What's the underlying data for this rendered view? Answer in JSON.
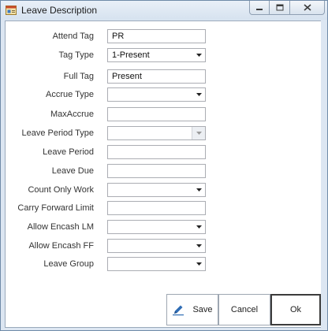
{
  "window": {
    "title": "Leave Description",
    "controls": [
      "minimize-icon",
      "maximize-icon",
      "close-icon"
    ]
  },
  "fields": [
    {
      "label": "Attend Tag",
      "type": "text",
      "value": "PR"
    },
    {
      "label": "Tag Type",
      "type": "combo",
      "value": "1-Present"
    },
    {
      "label": "Full Tag",
      "type": "text",
      "value": "Present"
    },
    {
      "label": "Accrue Type",
      "type": "combo",
      "value": ""
    },
    {
      "label": "MaxAccrue",
      "type": "text",
      "value": ""
    },
    {
      "label": "Leave Period Type",
      "type": "combo",
      "value": "",
      "disabled": true
    },
    {
      "label": "Leave Period",
      "type": "text",
      "value": ""
    },
    {
      "label": "Leave Due",
      "type": "text",
      "value": ""
    },
    {
      "label": "Count Only Work",
      "type": "combo",
      "value": ""
    },
    {
      "label": "Carry Forward Limit",
      "type": "text",
      "value": ""
    },
    {
      "label": "Allow Encash LM",
      "type": "combo",
      "value": ""
    },
    {
      "label": "Allow Encash FF",
      "type": "combo",
      "value": ""
    },
    {
      "label": "Leave Group",
      "type": "combo",
      "value": ""
    }
  ],
  "buttons": {
    "save": "Save",
    "cancel": "Cancel",
    "ok": "Ok"
  },
  "colors": {
    "titlebar": "#d6e2ef",
    "border": "#abadb3",
    "save_icon": "#2f6db5"
  }
}
